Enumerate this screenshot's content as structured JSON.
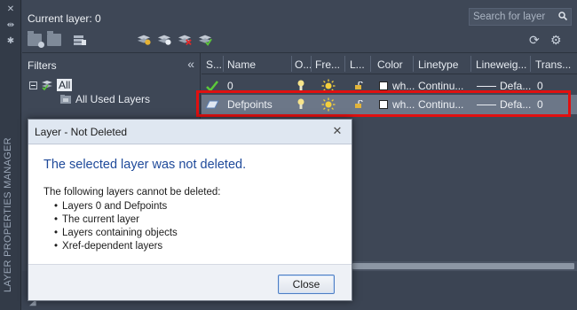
{
  "palette": {
    "panel": "#3e4756",
    "strip": "#333b48",
    "selected_row": "#6c7788",
    "highlight_border": "#e01010",
    "dialog_heading": "#1f4a9a",
    "checkmark": "#5cc83a"
  },
  "side_strip": {
    "vertical_title": "LAYER PROPERTIES MANAGER",
    "icons": [
      "close-icon",
      "pin-icon",
      "properties-icon"
    ]
  },
  "header": {
    "current_layer": "Current layer: 0",
    "search_placeholder": "Search for layer"
  },
  "toolbar": {
    "left_icons": [
      "new-property-filter-icon",
      "new-group-filter-icon",
      "layer-states-manager-icon"
    ],
    "layer_icons": [
      "new-layer-icon",
      "new-layer-vp-frozen-icon",
      "delete-layer-icon",
      "set-current-icon"
    ],
    "right_icons": [
      "refresh-icon",
      "settings-icon"
    ]
  },
  "filters": {
    "title": "Filters",
    "collapse_glyph": "«",
    "tree": [
      {
        "label": "All",
        "selected": true
      },
      {
        "label": "All Used Layers",
        "selected": false
      }
    ]
  },
  "grid": {
    "columns": [
      "S...",
      "Name",
      "O...",
      "Fre...",
      "L...",
      "Color",
      "Linetype",
      "Lineweig...",
      "Trans..."
    ],
    "rows": [
      {
        "status": "current",
        "name": "0",
        "color_name": "wh...",
        "linetype": "Continu...",
        "lineweight": "Defa...",
        "transparency": "0",
        "selected": false
      },
      {
        "status": "layer",
        "name": "Defpoints",
        "color_name": "wh...",
        "linetype": "Continu...",
        "lineweight": "Defa...",
        "transparency": "0",
        "selected": true
      }
    ]
  },
  "dialog": {
    "title": "Layer - Not Deleted",
    "heading": "The selected layer was not deleted.",
    "intro": "The following layers cannot be deleted:",
    "items": [
      "Layers 0 and Defpoints",
      "The current layer",
      "Layers containing objects",
      "Xref-dependent layers"
    ],
    "close_label": "Close",
    "close_glyph": "✕"
  }
}
